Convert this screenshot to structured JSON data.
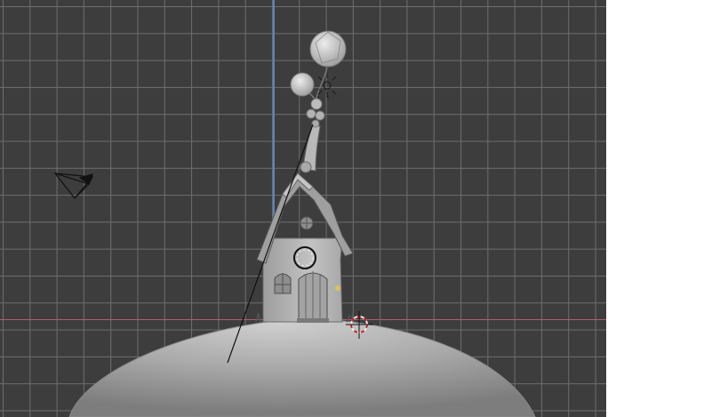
{
  "viewport": {
    "background_color": "#3d3d3d",
    "grid_color": "#6e6e6e",
    "x_axis_color": "#b35c6c",
    "y_axis_color": "#5a86c2"
  },
  "objects": [
    {
      "name": "camera",
      "icon": "camera-icon"
    },
    {
      "name": "house",
      "icon": "house-model"
    },
    {
      "name": "ground-mound",
      "icon": "mound-model"
    },
    {
      "name": "balloons",
      "icon": "balloon-model"
    },
    {
      "name": "light",
      "icon": "light-icon"
    },
    {
      "name": "3d-cursor",
      "icon": "crosshair-icon"
    }
  ]
}
